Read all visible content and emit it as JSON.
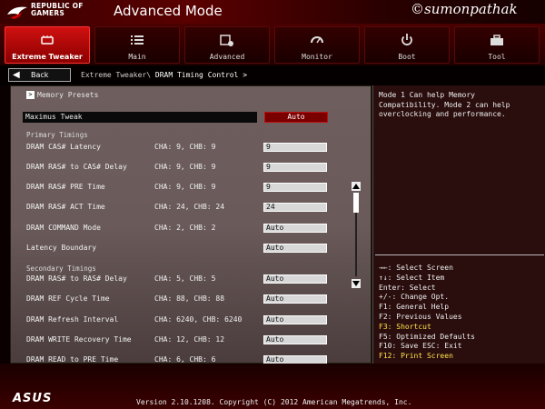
{
  "header": {
    "brand_line1": "REPUBLIC OF",
    "brand_line2": "GAMERS",
    "title": "Advanced Mode",
    "watermark": "©sumonpathak"
  },
  "tabs": [
    {
      "label": "Extreme Tweaker",
      "icon": "cpu-chip-icon",
      "active": true
    },
    {
      "label": "Main",
      "icon": "list-icon",
      "active": false
    },
    {
      "label": "Advanced",
      "icon": "chip-settings-icon",
      "active": false
    },
    {
      "label": "Monitor",
      "icon": "gauge-icon",
      "active": false
    },
    {
      "label": "Boot",
      "icon": "power-icon",
      "active": false
    },
    {
      "label": "Tool",
      "icon": "toolbox-icon",
      "active": false
    }
  ],
  "breadcrumb": {
    "back_label": "Back",
    "parent": "Extreme Tweaker\\",
    "current": "DRAM Timing Control >"
  },
  "memory_presets": "Memory Presets",
  "maximus_tweak": {
    "label": "Maximus Tweak",
    "value": "Auto"
  },
  "sections": {
    "primary": "Primary Timings",
    "secondary": "Secondary Timings"
  },
  "rows": [
    {
      "label": "DRAM CAS# Latency",
      "ch": "CHA:  9, CHB:  9",
      "value": "9"
    },
    {
      "label": "DRAM RAS# to CAS# Delay",
      "ch": "CHA:  9, CHB:  9",
      "value": "9"
    },
    {
      "label": "DRAM RAS# PRE Time",
      "ch": "CHA:  9, CHB:  9",
      "value": "9"
    },
    {
      "label": "DRAM RAS# ACT Time",
      "ch": "CHA: 24, CHB: 24",
      "value": "24"
    },
    {
      "label": "DRAM COMMAND Mode",
      "ch": "CHA:  2, CHB:  2",
      "value": "Auto"
    },
    {
      "label": "Latency Boundary",
      "ch": "",
      "value": "Auto"
    },
    {
      "label": "DRAM RAS# to RAS# Delay",
      "ch": "CHA:  5, CHB:  5",
      "value": "Auto"
    },
    {
      "label": "DRAM REF Cycle Time",
      "ch": "CHA: 88, CHB: 88",
      "value": "Auto"
    },
    {
      "label": "DRAM Refresh Interval",
      "ch": "CHA: 6240, CHB: 6240",
      "value": "Auto"
    },
    {
      "label": "DRAM WRITE Recovery Time",
      "ch": "CHA: 12, CHB: 12",
      "value": "Auto"
    },
    {
      "label": "DRAM READ to PRE Time",
      "ch": "CHA:  6, CHB:  6",
      "value": "Auto"
    }
  ],
  "help": {
    "text": "Mode 1 Can help Memory Compatibility. Mode 2 can help overclocking and performance."
  },
  "shortcuts": [
    {
      "text": "→←: Select Screen",
      "highlight": false
    },
    {
      "text": "↑↓: Select Item",
      "highlight": false
    },
    {
      "text": "Enter: Select",
      "highlight": false
    },
    {
      "text": "+/-: Change Opt.",
      "highlight": false
    },
    {
      "text": "F1: General Help",
      "highlight": false
    },
    {
      "text": "F2: Previous Values",
      "highlight": false
    },
    {
      "text": "F3: Shortcut",
      "highlight": true
    },
    {
      "text": "F5: Optimized Defaults",
      "highlight": false
    },
    {
      "text": "F10: Save  ESC: Exit",
      "highlight": false
    },
    {
      "text": "F12: Print Screen",
      "highlight": true
    }
  ],
  "footer": {
    "logo": "ASUS",
    "version": "Version 2.10.1208. Copyright (C) 2012 American Megatrends, Inc."
  },
  "colors": {
    "accent_red": "#d01010",
    "highlight_yellow": "#ffe34a"
  }
}
